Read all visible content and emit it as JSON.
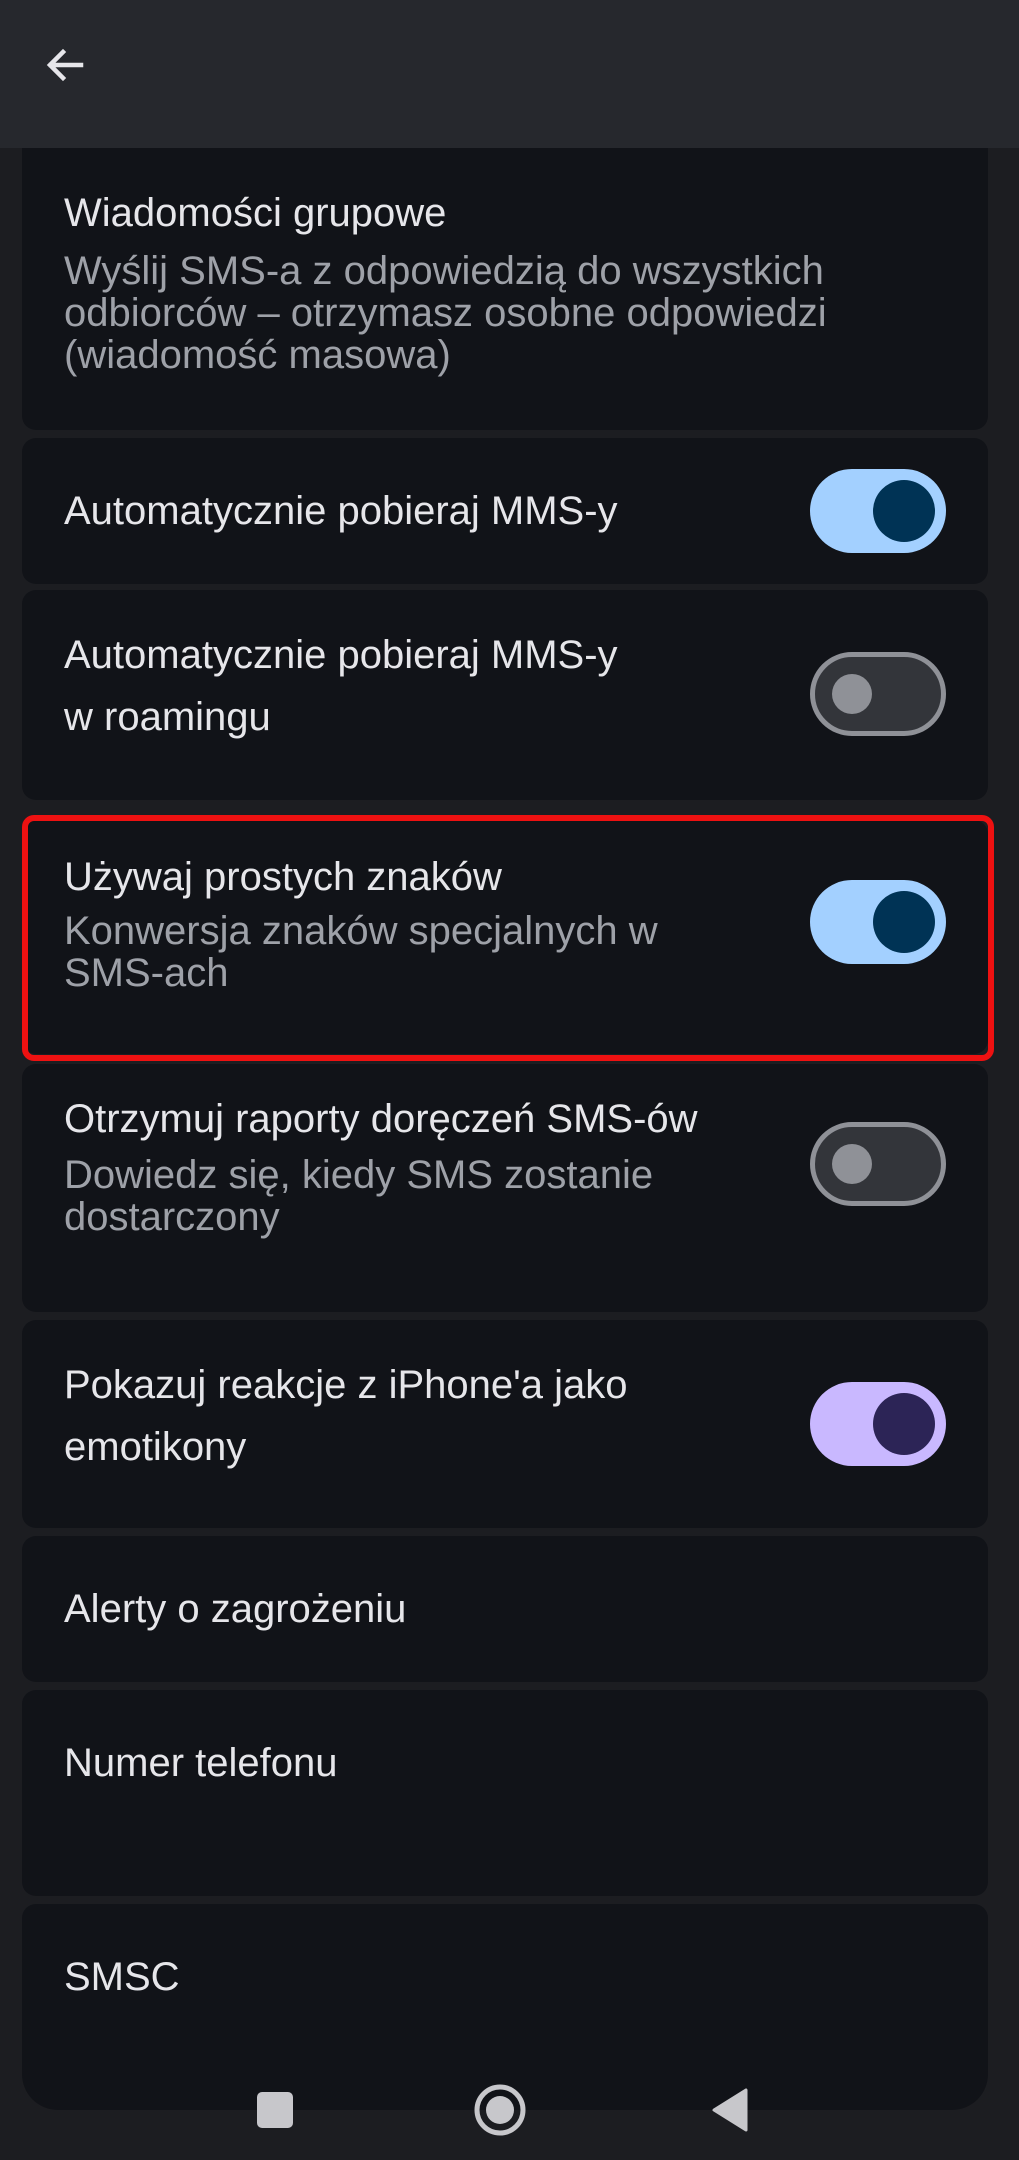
{
  "header": {
    "back_icon": "arrow-back-icon"
  },
  "settings": {
    "group_messages": {
      "title": "Wiadomości grupowe",
      "subtitle": "Wyślij SMS-a z odpowiedzią do wszystkich\nodbiorców – otrzymasz osobne odpowiedzi\n(wiadomość masowa)"
    },
    "auto_mms": {
      "title": "Automatycznie pobieraj MMS-y",
      "enabled": true
    },
    "auto_mms_roaming": {
      "title": "Automatycznie pobieraj MMS-y\nw roamingu",
      "enabled": false
    },
    "simple_chars": {
      "title": "Używaj prostych znaków",
      "subtitle": "Konwersja znaków specjalnych w\nSMS-ach",
      "enabled": true
    },
    "delivery_reports": {
      "title": "Otrzymuj raporty doręczeń SMS-ów",
      "subtitle": "Dowiedz się, kiedy SMS zostanie\ndostarczony",
      "enabled": false
    },
    "iphone_reactions": {
      "title": "Pokazuj reakcje z iPhone'a jako\nemotikony",
      "enabled": true
    },
    "emergency_alerts": {
      "title": "Alerty o zagrożeniu"
    },
    "phone_number": {
      "title": "Numer telefonu"
    },
    "smsc": {
      "title": "SMSC"
    }
  },
  "colors": {
    "background": "#1c1d21",
    "card": "#111318",
    "switch_on_blue": "#a3d0ff",
    "switch_on_purple": "#c9b8ff",
    "highlight": "#ee1111"
  },
  "navbar": {
    "recents_icon": "square-icon",
    "home_icon": "circle-home-icon",
    "back_icon": "triangle-back-icon"
  }
}
